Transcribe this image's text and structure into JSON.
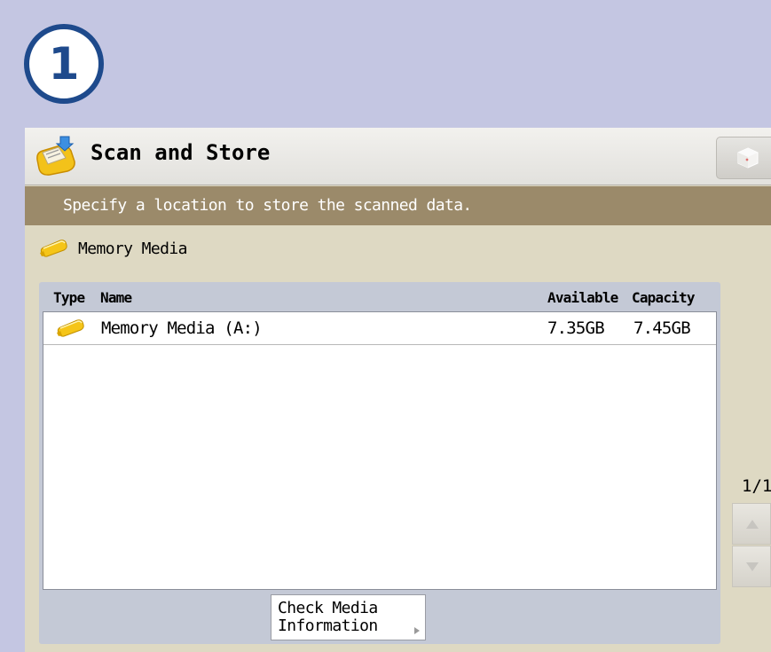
{
  "step_badge": "1",
  "header": {
    "title": "Scan and Store",
    "title_icon": "scan-store-icon",
    "corner_icon": "box-icon"
  },
  "instruction": "Specify a location to store the scanned data.",
  "location": {
    "icon": "usb-memory-icon",
    "label": "Memory Media"
  },
  "table": {
    "columns": [
      "Type",
      "Name",
      "Available",
      "Capacity"
    ],
    "rows": [
      {
        "type_icon": "usb-memory-icon",
        "name": "Memory Media (A:)",
        "available": "7.35GB",
        "capacity": "7.45GB"
      }
    ]
  },
  "check_media_button": {
    "line1": "Check Media",
    "line2": "Information"
  },
  "pagination": {
    "indicator": "1/1",
    "up_icon": "arrow-up-icon",
    "down_icon": "arrow-down-icon"
  },
  "colors": {
    "background": "#c4c6e2",
    "badge": "#1e4a8c",
    "instruction_bar": "#9b8a6a",
    "panel": "#ded9c3",
    "list_panel": "#c4c9d6"
  }
}
